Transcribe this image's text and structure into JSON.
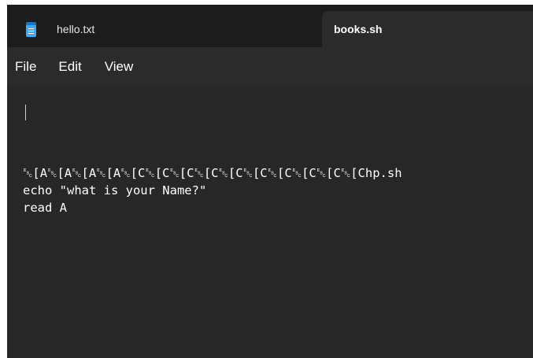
{
  "tabs": [
    {
      "label": "hello.txt",
      "active": false,
      "icon": "notepad-icon"
    },
    {
      "label": "books.sh",
      "active": true
    }
  ],
  "menu": {
    "file": "File",
    "edit": "Edit",
    "view": "View"
  },
  "editor": {
    "lines": [
      "␛[A␛[A␛[A␛[A␛[C␛[C␛[C␛[C␛[C␛[C␛[C␛[C␛[C␛[Chp.sh",
      "echo \"what is your Name?\"",
      "read A"
    ]
  },
  "colors": {
    "tabbar_bg": "#1c1c1c",
    "active_tab_bg": "#2b2b2b",
    "editor_bg": "#272727",
    "text": "#ffffff",
    "icon_accent": "#3fa9f5"
  }
}
